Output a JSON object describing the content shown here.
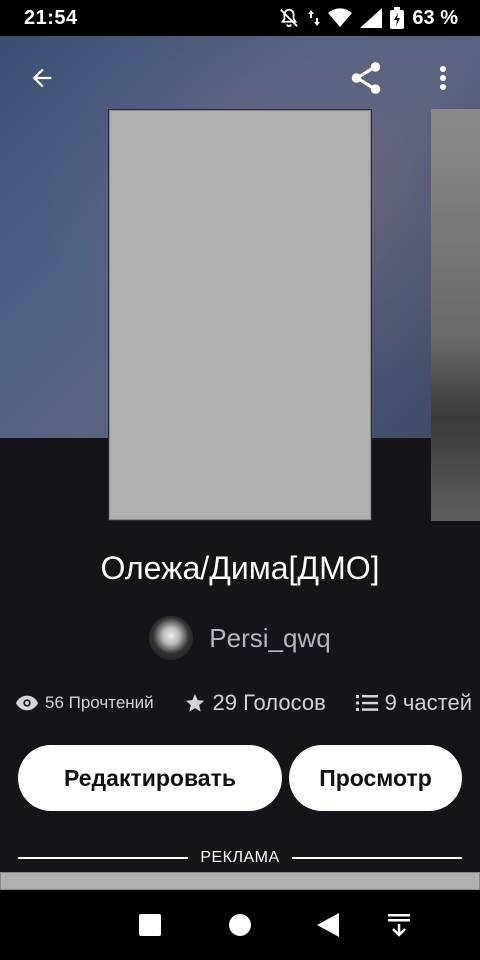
{
  "status_bar": {
    "time": "21:54",
    "battery_percent": "63 %",
    "icons": [
      "bell-off-icon",
      "data-arrows-icon",
      "wifi-icon",
      "signal-icon",
      "battery-icon"
    ]
  },
  "top_bar": {
    "icons": [
      "back-arrow-icon",
      "share-icon",
      "more-vert-icon"
    ]
  },
  "story": {
    "title": "Олежа/Дима[ДМО]",
    "author": "Persi_qwq",
    "reads": "56 Прочтений",
    "votes": "29 Голосов",
    "parts": "9 частей"
  },
  "actions": {
    "edit_label": "Редактировать",
    "preview_label": "Просмотр"
  },
  "ad": {
    "label": "РЕКЛАМА"
  },
  "nav_bar": {
    "icons": [
      "recents-square-icon",
      "home-circle-icon",
      "back-triangle-icon",
      "hide-nav-icon"
    ]
  },
  "colors": {
    "background": "#151418",
    "button_bg": "#ffffff",
    "button_text": "#121212",
    "muted_text": "#b6b6bc"
  }
}
